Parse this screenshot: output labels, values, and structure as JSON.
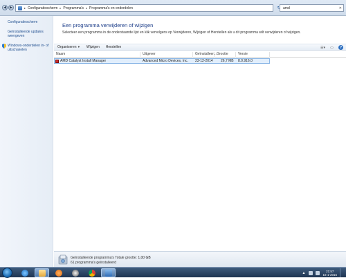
{
  "address_bar": {
    "breadcrumbs": [
      "Configuratiescherm",
      "Programma's",
      "Programma's en onderdelen"
    ],
    "search_value": "amd"
  },
  "left_pane": {
    "links": [
      "Configuratiescherm",
      "Geïnstalleerde updates weergeven",
      "Windows-onderdelen in- of uitschakelen"
    ]
  },
  "main": {
    "title": "Een programma verwijderen of wijzigen",
    "subtitle": "Selecteer een programma in de onderstaande lijst en klik vervolgens op Verwijderen, Wijzigen of Herstellen als u dit programma wilt verwijderen of wijzigen."
  },
  "toolbar": {
    "organize_label": "Organiseren",
    "change_label": "Wijzigen",
    "repair_label": "Herstellen"
  },
  "table": {
    "columns": [
      "Naam",
      "Uitgever",
      "Geïnstalleer...",
      "Grootte",
      "Versie"
    ],
    "rows": [
      {
        "name": "AMD Catalyst Install Manager",
        "publisher": "Advanced Micro Devices, Inc.",
        "installed": "23-12-2014",
        "size": "26,7 MB",
        "version": "8.0.916.0",
        "selected": true
      }
    ]
  },
  "details": {
    "label": "Geïnstalleerde programma's",
    "total_label": "Totale grootte:",
    "total_value": "1,00 GB",
    "count_text": "61 programma's geïnstalleerd"
  },
  "taskbar": {
    "clock_time": "21:57",
    "clock_date": "16-1-2015"
  },
  "colors": {
    "title": "#1e3f8a",
    "link": "#1f4e8f",
    "selection_bg": "#e1eefc",
    "selection_border": "#8bb7e6",
    "taskbar": "#1f3552"
  }
}
